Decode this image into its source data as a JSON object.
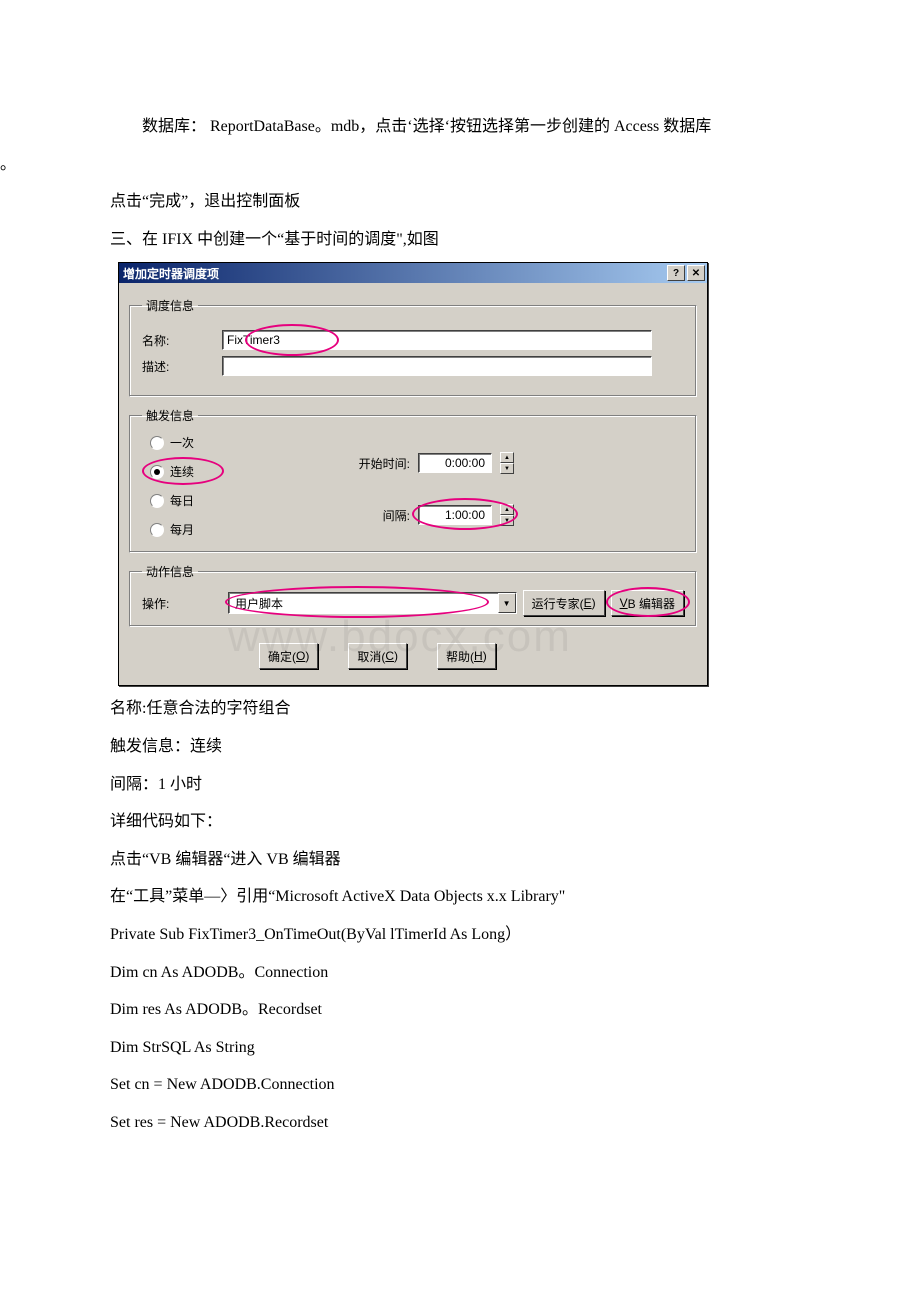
{
  "paragraphs": {
    "p1_indent": "数据库： ReportDataBase。mdb，点击‘选择‘按钮选择第一步创建的 Access 数据库",
    "p1_full_dot": "。",
    "p2": "点击“完成”，退出控制面板",
    "p3": "三、在 IFIX 中创建一个“基于时间的调度\",如图",
    "after_img_1": "名称:任意合法的字符组合",
    "after_img_2": "触发信息：连续",
    "after_img_3": "间隔：1 小时",
    "after_img_4": "详细代码如下：",
    "after_img_5": "点击“VB 编辑器“进入 VB 编辑器",
    "after_img_6": "在“工具”菜单—〉引用“Microsoft ActiveX Data Objects x.x Library\"",
    "code_1": "Private Sub FixTimer3_OnTimeOut(ByVal lTimerId As Long）",
    "code_2": "Dim cn As ADODB。Connection",
    "code_3": "Dim res As ADODB。Recordset",
    "code_4": "Dim StrSQL As String",
    "code_5": "Set cn = New ADODB.Connection",
    "code_6": "Set res = New ADODB.Recordset"
  },
  "dialog": {
    "title": "增加定时器调度项",
    "help_glyph": "?",
    "close_glyph": "✕",
    "group_schedule": "调度信息",
    "name_label": "名称:",
    "name_value": "FixTimer3",
    "desc_label": "描述:",
    "desc_value": "",
    "group_trigger": "触发信息",
    "radio_once": "一次",
    "radio_cont": "连续",
    "radio_daily": "每日",
    "radio_monthly": "每月",
    "start_label": "开始时间:",
    "start_value": " 0:00:00",
    "interval_label": "间隔:",
    "interval_value": " 1:00:00",
    "group_action": "动作信息",
    "action_label": "操作:",
    "action_value": "用户脚本",
    "run_expert_pre": "运行专家(",
    "run_expert_key": "E",
    "run_expert_post": ")",
    "vb_pre": "",
    "vb_key": "V",
    "vb_mid": "B 编辑器",
    "ok_pre": "确定(",
    "ok_key": "O",
    "ok_post": ")",
    "cancel_pre": "取消(",
    "cancel_key": "C",
    "cancel_post": ")",
    "help_pre": "帮助(",
    "help_key": "H",
    "help_post": ")"
  },
  "watermark": "www.bdocx.com"
}
